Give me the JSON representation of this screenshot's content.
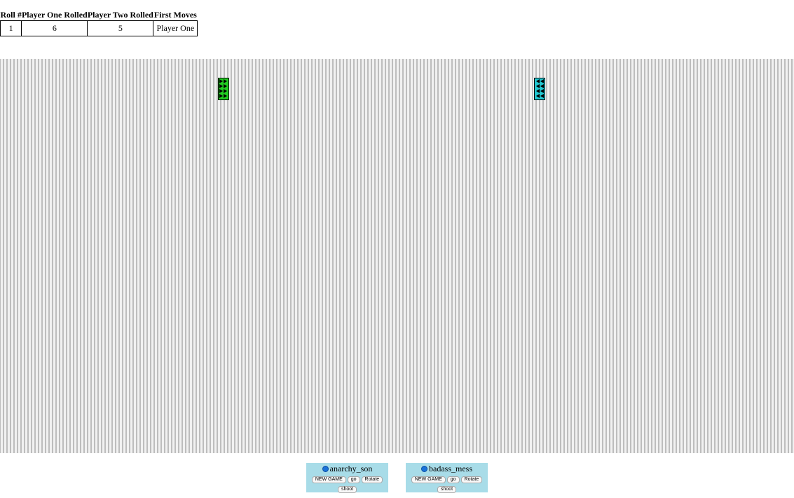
{
  "roll_table": {
    "headers": [
      "Roll #",
      "Player One Rolled",
      "Player Two Rolled",
      "First Moves"
    ],
    "rows": [
      [
        "1",
        "6",
        "5",
        "Player One"
      ]
    ]
  },
  "board": {
    "background_color": "#c9c9c9",
    "tanks": [
      {
        "owner": "Player One",
        "color": "#22cc22"
      },
      {
        "owner": "Player Two",
        "color": "#22c8d2"
      }
    ]
  },
  "players": [
    {
      "username": "anarchy_son",
      "status_icon": "status-dot-icon",
      "buttons": {
        "new_game": "NEW GAME",
        "go": "go",
        "rotate": "Rotate",
        "shoot": "shoot"
      }
    },
    {
      "username": "badass_mess",
      "status_icon": "status-dot-icon",
      "buttons": {
        "new_game": "NEW GAME",
        "go": "go",
        "rotate": "Rotate",
        "shoot": "shoot"
      }
    }
  ]
}
